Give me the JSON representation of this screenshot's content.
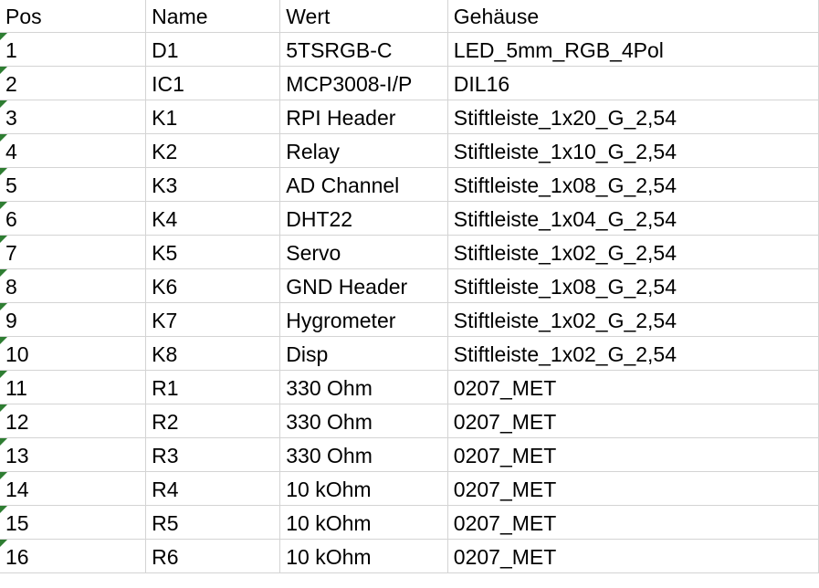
{
  "header": {
    "pos": "Pos",
    "name": "Name",
    "wert": "Wert",
    "gehaeuse": "Gehäuse"
  },
  "colors": {
    "gridline": "#d4d4d4",
    "number_stored_as_text_marker": "#2e7d32"
  },
  "rows": [
    {
      "pos": "1",
      "name": "D1",
      "wert": "5TSRGB-C",
      "gehaeuse": "LED_5mm_RGB_4Pol"
    },
    {
      "pos": "2",
      "name": "IC1",
      "wert": "MCP3008-I/P",
      "gehaeuse": "DIL16"
    },
    {
      "pos": "3",
      "name": "K1",
      "wert": "RPI Header",
      "gehaeuse": "Stiftleiste_1x20_G_2,54"
    },
    {
      "pos": "4",
      "name": "K2",
      "wert": "Relay",
      "gehaeuse": "Stiftleiste_1x10_G_2,54"
    },
    {
      "pos": "5",
      "name": "K3",
      "wert": "AD Channel",
      "gehaeuse": "Stiftleiste_1x08_G_2,54"
    },
    {
      "pos": "6",
      "name": "K4",
      "wert": "DHT22",
      "gehaeuse": "Stiftleiste_1x04_G_2,54"
    },
    {
      "pos": "7",
      "name": "K5",
      "wert": "Servo",
      "gehaeuse": "Stiftleiste_1x02_G_2,54"
    },
    {
      "pos": "8",
      "name": "K6",
      "wert": "GND Header",
      "gehaeuse": "Stiftleiste_1x08_G_2,54"
    },
    {
      "pos": "9",
      "name": "K7",
      "wert": "Hygrometer",
      "gehaeuse": "Stiftleiste_1x02_G_2,54"
    },
    {
      "pos": "10",
      "name": "K8",
      "wert": "Disp",
      "gehaeuse": "Stiftleiste_1x02_G_2,54"
    },
    {
      "pos": "11",
      "name": "R1",
      "wert": "330 Ohm",
      "gehaeuse": "0207_MET"
    },
    {
      "pos": "12",
      "name": "R2",
      "wert": "330 Ohm",
      "gehaeuse": "0207_MET"
    },
    {
      "pos": "13",
      "name": "R3",
      "wert": "330 Ohm",
      "gehaeuse": "0207_MET"
    },
    {
      "pos": "14",
      "name": "R4",
      "wert": "10 kOhm",
      "gehaeuse": "0207_MET"
    },
    {
      "pos": "15",
      "name": "R5",
      "wert": "10 kOhm",
      "gehaeuse": "0207_MET"
    },
    {
      "pos": "16",
      "name": "R6",
      "wert": "10 kOhm",
      "gehaeuse": "0207_MET"
    }
  ]
}
